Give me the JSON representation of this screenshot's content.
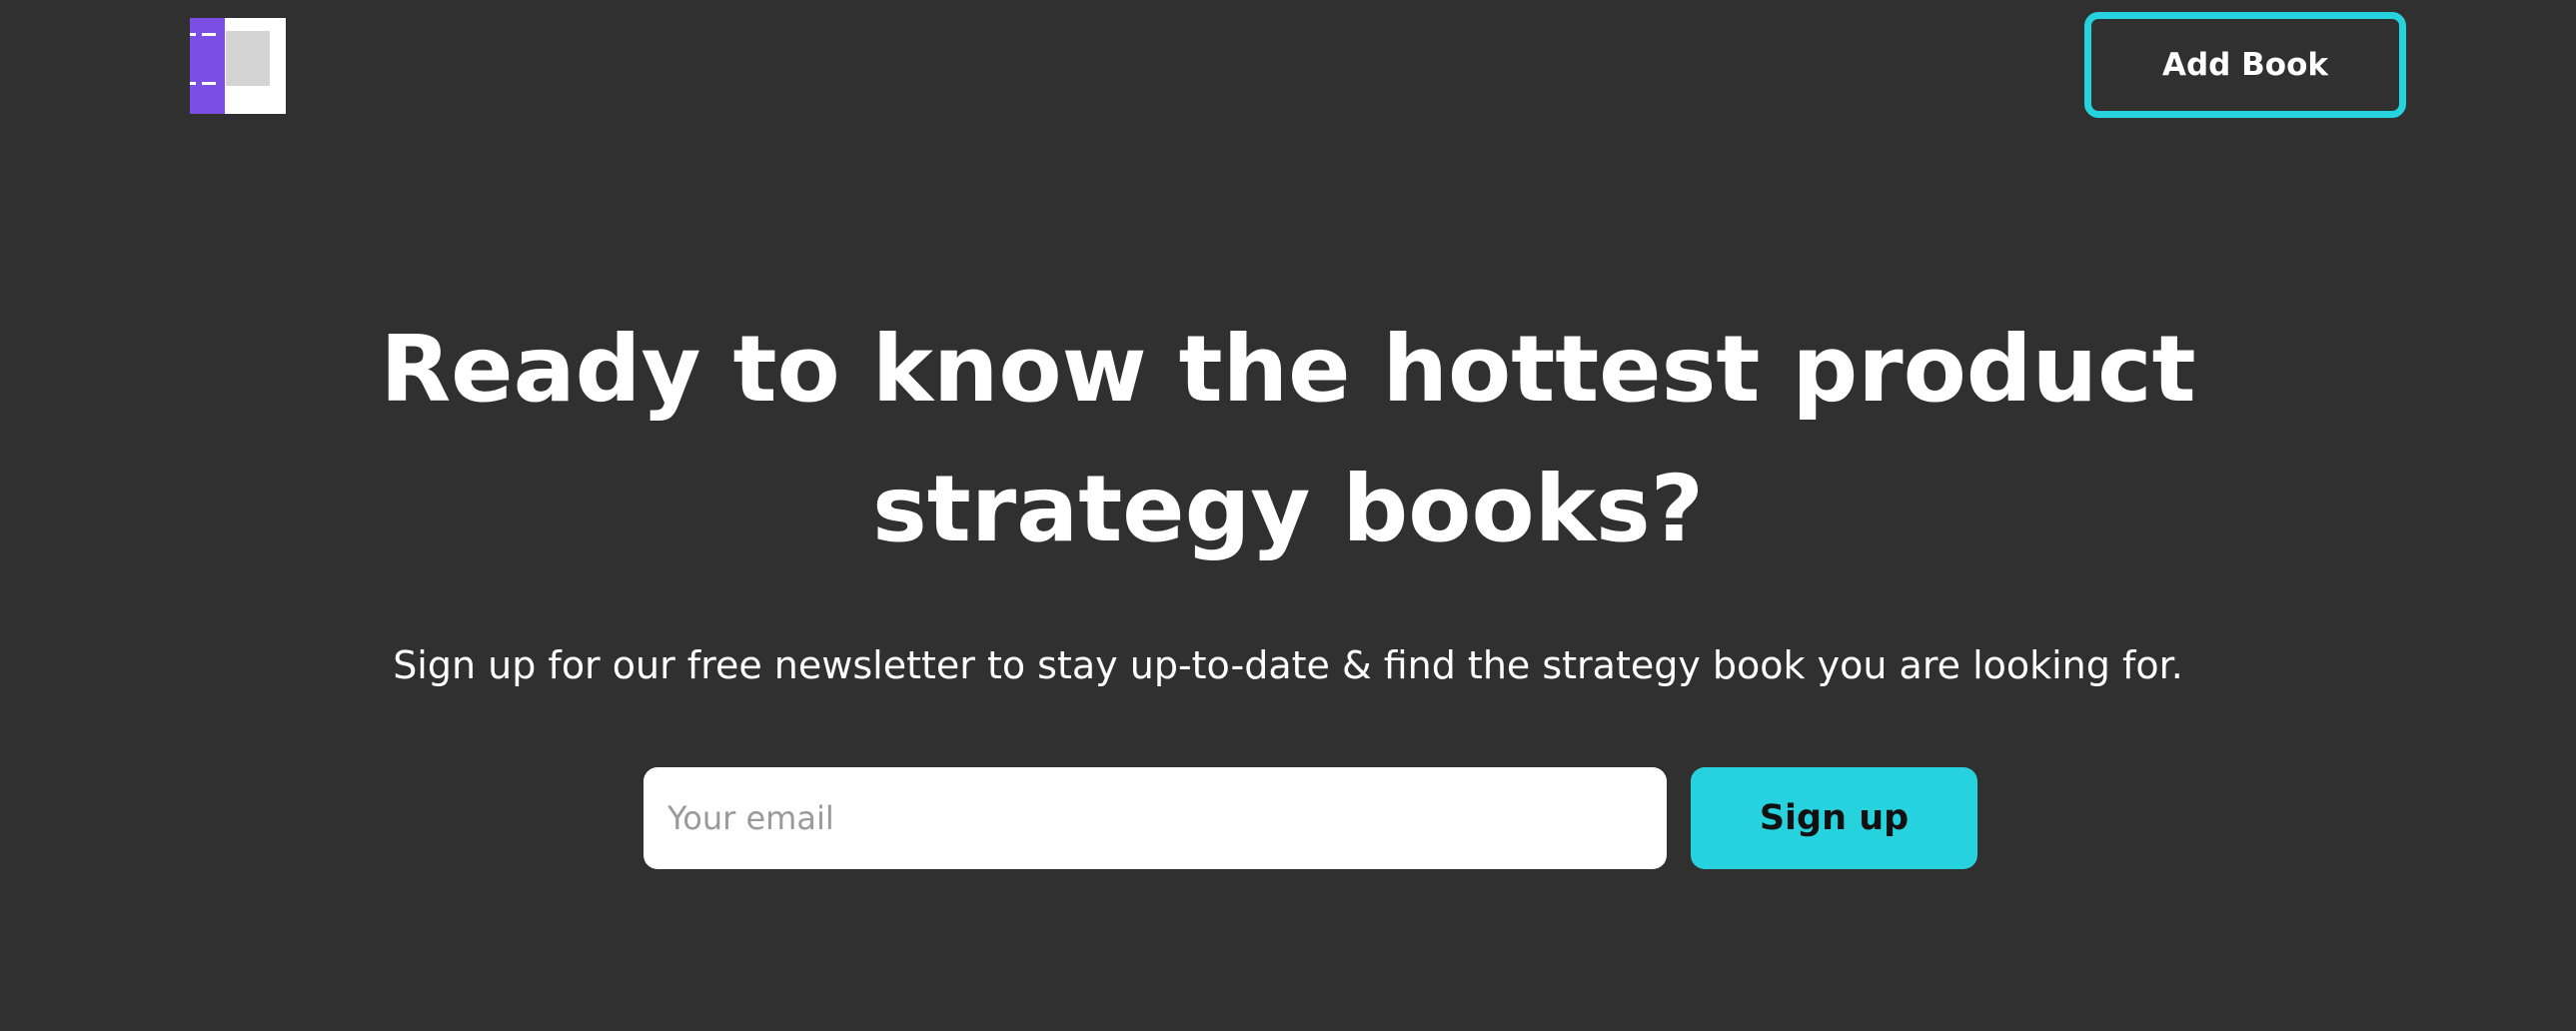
{
  "colors": {
    "background": "#303030",
    "accent": "#26d2de",
    "logo_spine": "#7b4ee6",
    "logo_cover": "#ffffff",
    "logo_label": "#d4d4d4",
    "text": "#ffffff"
  },
  "header": {
    "logo_icon": "book-logo-icon",
    "add_book_label": "Add Book"
  },
  "hero": {
    "title": "Ready to know the hottest product strategy books?",
    "subtitle": "Sign up for our free newsletter to stay up-to-date & find the strategy book you are looking for."
  },
  "signup": {
    "email_placeholder": "Your email",
    "email_value": "",
    "button_label": "Sign up"
  }
}
